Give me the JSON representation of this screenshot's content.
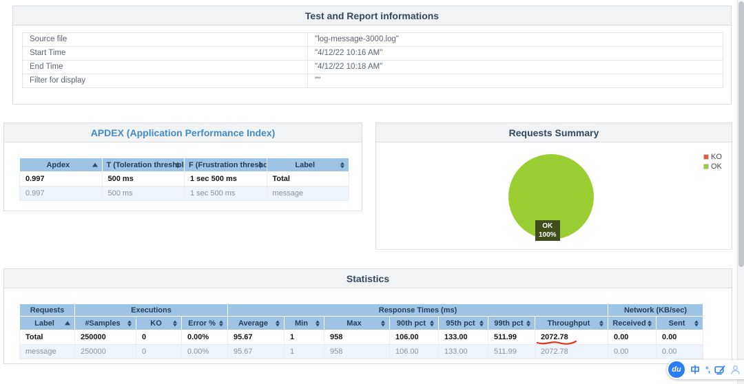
{
  "colors": {
    "header_blue": "#9dc3e6",
    "panel_title_dark": "#34495e",
    "link_blue": "#428bca",
    "ok_green": "#9acd32",
    "ko_red": "#e8563d",
    "pie_label_bg": "#3f4d1a",
    "alt_row_blue": "#eef4fb",
    "annotation_red": "#e0361f",
    "ime_blue": "#2a7cf7"
  },
  "test_info": {
    "title": "Test and Report informations",
    "rows": [
      {
        "label": "Source file",
        "value": "\"log-message-3000.log\""
      },
      {
        "label": "Start Time",
        "value": "\"4/12/22 10:16 AM\""
      },
      {
        "label": "End Time",
        "value": "\"4/12/22 10:18 AM\""
      },
      {
        "label": "Filter for display",
        "value": "\"\""
      }
    ]
  },
  "apdex": {
    "title": "APDEX (Application Performance Index)",
    "columns": [
      "Apdex",
      "T (Toleration threshold)",
      "F (Frustration threshold)",
      "Label"
    ],
    "rows": [
      [
        "0.997",
        "500 ms",
        "1 sec 500 ms",
        "Total"
      ],
      [
        "0.997",
        "500 ms",
        "1 sec 500 ms",
        "message"
      ]
    ]
  },
  "requests_summary": {
    "title": "Requests Summary",
    "legend": [
      {
        "label": "KO",
        "color": "#e8563d"
      },
      {
        "label": "OK",
        "color": "#9acd32"
      }
    ],
    "pie_label": {
      "line1": "OK",
      "line2": "100%"
    }
  },
  "statistics": {
    "title": "Statistics",
    "groups": [
      {
        "label": "Requests",
        "span": 1
      },
      {
        "label": "Executions",
        "span": 3
      },
      {
        "label": "Response Times (ms)",
        "span": 7
      },
      {
        "label": "Network (KB/sec)",
        "span": 2
      }
    ],
    "columns": [
      "Label",
      "#Samples",
      "KO",
      "Error %",
      "Average",
      "Min",
      "Max",
      "90th pct",
      "95th pct",
      "99th pct",
      "Throughput",
      "Received",
      "Sent"
    ],
    "rows": [
      [
        "Total",
        "250000",
        "0",
        "0.00%",
        "95.67",
        "1",
        "958",
        "106.00",
        "133.00",
        "511.99",
        "2072.78",
        "0.00",
        "0.00"
      ],
      [
        "message",
        "250000",
        "0",
        "0.00%",
        "95.67",
        "1",
        "958",
        "106.00",
        "133.00",
        "511.99",
        "2072.78",
        "0.00",
        "0.00"
      ]
    ]
  },
  "ime_toolbar": {
    "logo_text": "du",
    "lang_mode": "中",
    "punctuation": "°,"
  },
  "chart_data": {
    "type": "pie",
    "title": "Requests Summary",
    "slices": [
      {
        "label": "OK",
        "value": 100,
        "color": "#9acd32"
      },
      {
        "label": "KO",
        "value": 0,
        "color": "#e8563d"
      }
    ],
    "legend_position": "top-right",
    "slice_label": "OK 100%"
  }
}
